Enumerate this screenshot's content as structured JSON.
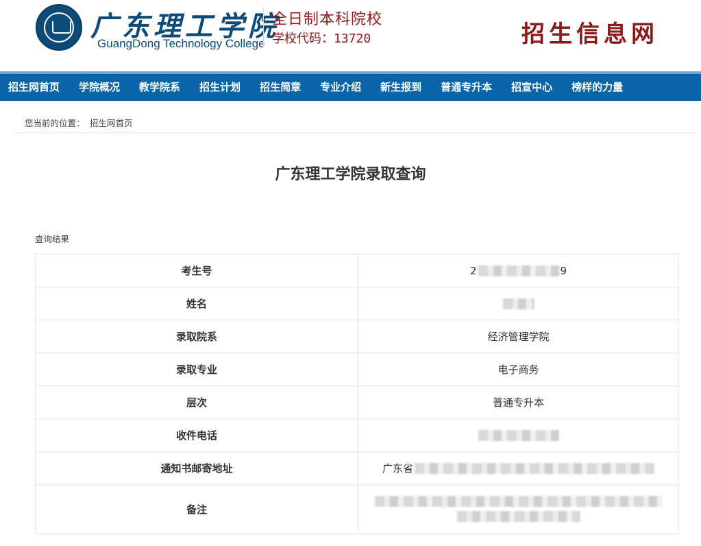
{
  "header": {
    "school_name_cn": "广东理工学院",
    "school_name_en": "GuangDong Technology College",
    "tagline": "全日制本科院校",
    "school_code": "学校代码：13720",
    "portal_title": "招生信息网"
  },
  "nav": {
    "items": [
      "招生网首页",
      "学院概况",
      "教学院系",
      "招生计划",
      "招生简章",
      "专业介绍",
      "新生报到",
      "普通专升本",
      "招宣中心",
      "榜样的力量"
    ]
  },
  "breadcrumb": {
    "prefix": "您当前的位置：",
    "current": "招生网首页"
  },
  "page_title": "广东理工学院录取查询",
  "result_label": "查询结果",
  "result": {
    "rows": [
      {
        "label": "考生号",
        "value_prefix": "2",
        "value_suffix": "9",
        "redacted": true
      },
      {
        "label": "姓名",
        "value_prefix": "",
        "value_suffix": "",
        "redacted": true
      },
      {
        "label": "录取院系",
        "value": "经济管理学院"
      },
      {
        "label": "录取专业",
        "value": "电子商务"
      },
      {
        "label": "层次",
        "value": "普通专升本"
      },
      {
        "label": "收件电话",
        "value_prefix": "",
        "value_suffix": "",
        "redacted": true
      },
      {
        "label": "通知书邮寄地址",
        "value_prefix": "广东省",
        "value_suffix": "",
        "redacted": true
      },
      {
        "label": "备注",
        "value_prefix": "",
        "value_suffix": "",
        "redacted": true
      }
    ]
  },
  "colors": {
    "nav_bg": "#0a65a8",
    "brand_blue": "#0d4a78",
    "brand_red": "#8b1a1a"
  }
}
